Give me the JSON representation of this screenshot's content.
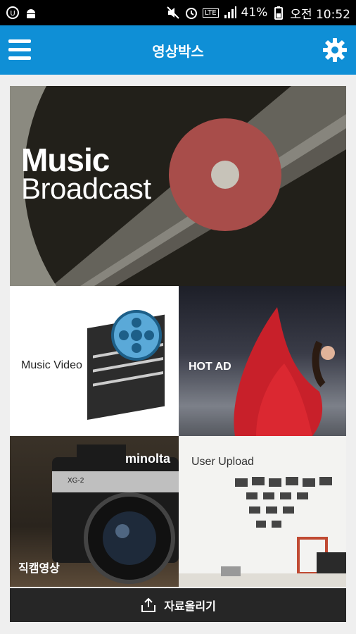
{
  "status_bar": {
    "battery": "41%",
    "time": "오전 10:52",
    "lte": "LTE"
  },
  "app_bar": {
    "title": "영상박스"
  },
  "banner": {
    "line1": "Music",
    "line2": "Broadcast"
  },
  "tiles": [
    {
      "label": "Music Video"
    },
    {
      "label": "HOT AD"
    },
    {
      "label": "직캠영상",
      "camera_brand": "minolta",
      "camera_model": "XG-2"
    },
    {
      "label": "User Upload"
    }
  ],
  "bottom_bar": {
    "label": "자료올리기"
  },
  "colors": {
    "app_bar": "#0f8fd6",
    "record_label": "#a84d4a"
  }
}
